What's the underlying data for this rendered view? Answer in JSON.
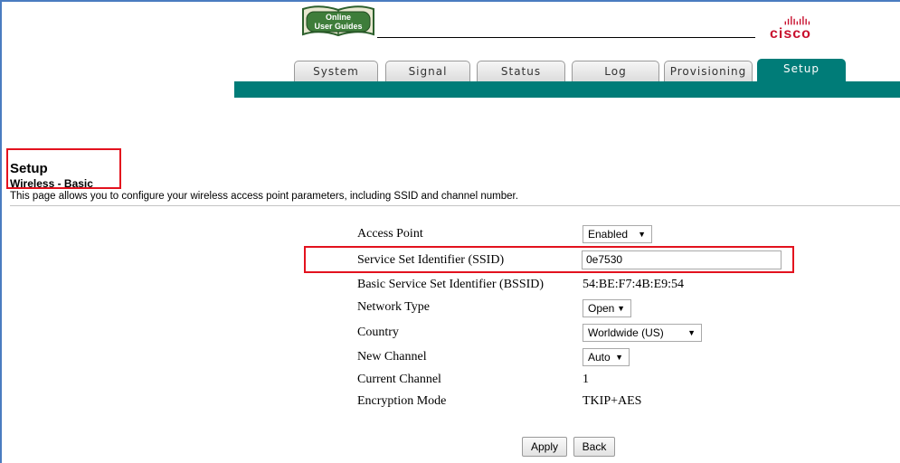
{
  "header": {
    "logo_line1": "Online",
    "logo_line2": "User Guides",
    "brand": "cisco"
  },
  "tabs": [
    {
      "label": "System",
      "active": false
    },
    {
      "label": "Signal",
      "active": false
    },
    {
      "label": "Status",
      "active": false
    },
    {
      "label": "Log",
      "active": false
    },
    {
      "label": "Provisioning",
      "active": false
    },
    {
      "label": "Setup",
      "active": true
    }
  ],
  "page": {
    "title": "Setup",
    "subtitle": "Wireless - Basic",
    "description": "This page allows you to configure your wireless access point parameters, including SSID and channel number."
  },
  "form": {
    "access_point": {
      "label": "Access Point",
      "value": "Enabled"
    },
    "ssid": {
      "label": "Service Set Identifier (SSID)",
      "value": "0e7530"
    },
    "bssid": {
      "label": "Basic Service Set Identifier (BSSID)",
      "value": "54:BE:F7:4B:E9:54"
    },
    "network_type": {
      "label": "Network Type",
      "value": "Open"
    },
    "country": {
      "label": "Country",
      "value": "Worldwide (US)"
    },
    "new_channel": {
      "label": "New Channel",
      "value": "Auto"
    },
    "current_channel": {
      "label": "Current Channel",
      "value": "1"
    },
    "encryption_mode": {
      "label": "Encryption Mode",
      "value": "TKIP+AES"
    }
  },
  "buttons": {
    "apply": "Apply",
    "back": "Back"
  },
  "colors": {
    "teal": "#007c78",
    "highlight_red": "#e3121e",
    "cisco_red": "#c8102e",
    "frame_blue": "#4a7cc0"
  },
  "icons": {
    "dropdown": "triangle-down",
    "logo": "open-book",
    "brand": "cisco-bars"
  }
}
